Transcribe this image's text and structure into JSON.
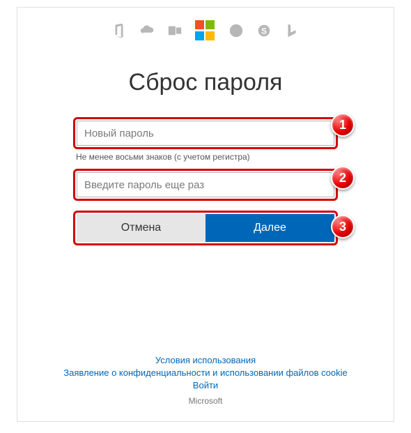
{
  "icons": [
    "office-icon",
    "onedrive-icon",
    "outlook-icon",
    "microsoft-logo",
    "xbox-icon",
    "skype-icon",
    "bing-icon"
  ],
  "title": "Сброс пароля",
  "form": {
    "new_password_placeholder": "Новый пароль",
    "hint": "Не менее восьми знаков (с учетом регистра)",
    "confirm_password_placeholder": "Введите пароль еще раз",
    "cancel_label": "Отмена",
    "next_label": "Далее"
  },
  "badges": {
    "one": "1",
    "two": "2",
    "three": "3"
  },
  "footer": {
    "terms": "Условия использования",
    "privacy": "Заявление о конфиденциальности и использовании файлов cookie",
    "signin": "Войти",
    "copyright": "Microsoft"
  },
  "colors": {
    "accent": "#0067b8",
    "highlight": "#d40000"
  }
}
